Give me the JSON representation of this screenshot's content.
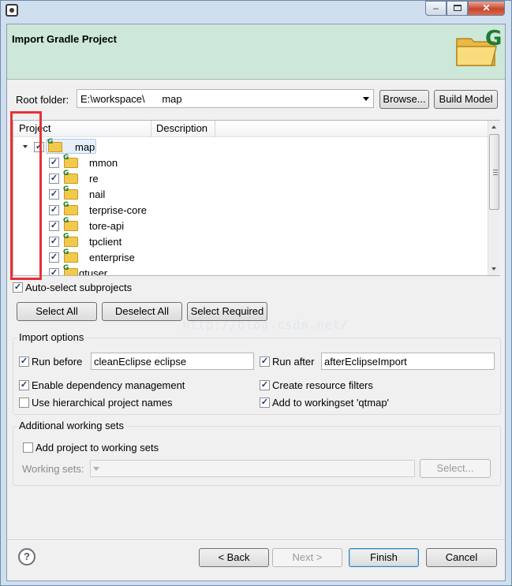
{
  "window": {
    "close_glyph": "✕",
    "minimize_glyph": "–"
  },
  "banner": {
    "title": "Import Gradle Project",
    "logo_letter": "G"
  },
  "root": {
    "label": "Root folder:",
    "value": "E:\\workspace\\      map",
    "browse_label": "Browse...",
    "build_model_label": "Build Model"
  },
  "tree": {
    "columns": [
      "Project",
      "Description"
    ],
    "root_node": {
      "label": "map",
      "checked": true
    },
    "children": [
      {
        "label": "mmon",
        "checked": true
      },
      {
        "label": "re",
        "checked": true
      },
      {
        "label": "nail",
        "checked": true
      },
      {
        "label": "terprise-core",
        "checked": true
      },
      {
        "label": "tore-api",
        "checked": true
      },
      {
        "label": "tpclient",
        "checked": true
      },
      {
        "label": "enterprise",
        "checked": true
      },
      {
        "label": "qtuser",
        "checked": true
      }
    ]
  },
  "auto_select": {
    "label": "Auto-select subprojects",
    "checked": true
  },
  "watermark": "http://blog.csdn.net/",
  "selection_buttons": {
    "select_all": "Select All",
    "deselect_all": "Deselect All",
    "select_required": "Select Required"
  },
  "import_options": {
    "title": "Import options",
    "run_before": {
      "label": "Run before",
      "checked": true,
      "value": "cleanEclipse eclipse"
    },
    "run_after": {
      "label": "Run after",
      "checked": true,
      "value": "afterEclipseImport"
    },
    "dependency_mgmt": {
      "label": "Enable dependency management",
      "checked": true
    },
    "resource_filters": {
      "label": "Create resource filters",
      "checked": true
    },
    "hierarchical_names": {
      "label": "Use hierarchical project names",
      "checked": false
    },
    "add_workingset": {
      "label": "Add to workingset 'qtmap'",
      "checked": true
    }
  },
  "working_sets": {
    "title": "Additional working sets",
    "add_label": "Add project to working sets",
    "add_checked": false,
    "sets_label": "Working sets:",
    "sets_value": "",
    "select_label": "Select..."
  },
  "footer": {
    "help": "?",
    "back": "< Back",
    "next": "Next >",
    "finish": "Finish",
    "cancel": "Cancel"
  },
  "colors": {
    "banner_bg": "#cde8d9",
    "annotation_red": "#e53238",
    "frame": "#cfdff0"
  }
}
